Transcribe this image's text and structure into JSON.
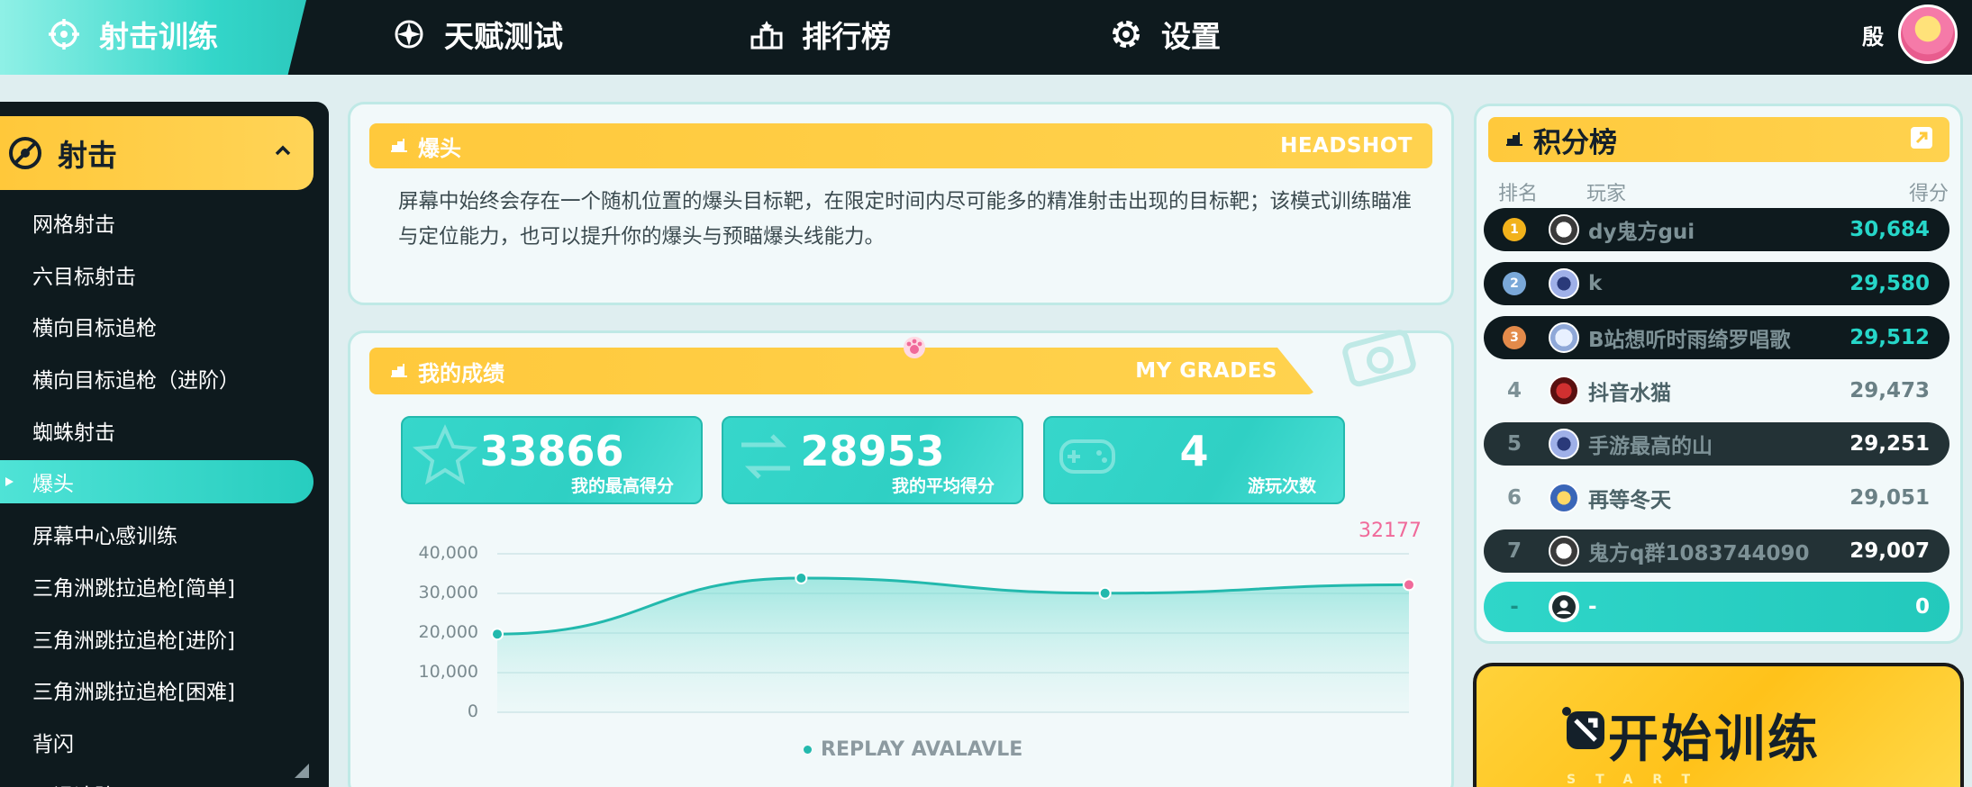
{
  "topnav": {
    "items": [
      {
        "label": "射击训练",
        "icon": "crosshair-icon",
        "active": true
      },
      {
        "label": "天赋测试",
        "icon": "compass-icon"
      },
      {
        "label": "排行榜",
        "icon": "podium-icon"
      },
      {
        "label": "设置",
        "icon": "gear-icon"
      }
    ],
    "user_name": "殷"
  },
  "sidebar": {
    "section_label": "射击",
    "items": [
      {
        "label": "网格射击"
      },
      {
        "label": "六目标射击"
      },
      {
        "label": "横向目标追枪"
      },
      {
        "label": "横向目标追枪（进阶）"
      },
      {
        "label": "蜘蛛射击"
      },
      {
        "label": "爆头",
        "active": true
      },
      {
        "label": "屏幕中心感训练"
      },
      {
        "label": "三角洲跳拉追枪[简单]"
      },
      {
        "label": "三角洲跳拉追枪[进阶]"
      },
      {
        "label": "三角洲跳拉追枪[困难]"
      },
      {
        "label": "背闪"
      },
      {
        "label": "平滑追踪"
      }
    ]
  },
  "mode": {
    "title": "爆头",
    "title_en": "HEADSHOT",
    "description": "屏幕中始终会存在一个随机位置的爆头目标靶，在限定时间内尽可能多的精准射击出现的目标靶；该模式训练瞄准与定位能力，也可以提升你的爆头与预瞄爆头线能力。"
  },
  "grades": {
    "title": "我的成绩",
    "title_en": "MY GRADES",
    "stats": [
      {
        "value": "33866",
        "caption": "我的最高得分"
      },
      {
        "value": "28953",
        "caption": "我的平均得分"
      },
      {
        "value": "4",
        "caption": "游玩次数"
      }
    ],
    "replay_label": "REPLAY AVALAVLE"
  },
  "chart_data": {
    "type": "area",
    "y_ticks": [
      "40,000",
      "30,000",
      "20,000",
      "10,000",
      "0"
    ],
    "ylim": [
      0,
      40000
    ],
    "x": [
      1,
      2,
      3,
      4
    ],
    "values": [
      19725,
      33866,
      30044,
      32177
    ],
    "last_label": "32177",
    "colors": {
      "line": "#23b9ad",
      "last_point": "#f06a9a"
    }
  },
  "leaderboard": {
    "title": "积分榜",
    "columns": [
      "排名",
      "玩家",
      "得分"
    ],
    "rows": [
      {
        "rank": "1",
        "name": "dy鬼方gui",
        "score": "30,684",
        "medal_color": "#f2b21b"
      },
      {
        "rank": "2",
        "name": "k",
        "score": "29,580",
        "medal_color": "#7aa8d8"
      },
      {
        "rank": "3",
        "name": "B站想听时雨绮罗唱歌",
        "score": "29,512",
        "medal_color": "#e38a4a"
      },
      {
        "rank": "4",
        "name": "抖音水猫",
        "score": "29,473"
      },
      {
        "rank": "5",
        "name": "手游最高的山",
        "score": "29,251"
      },
      {
        "rank": "6",
        "name": "再等冬天",
        "score": "29,051"
      },
      {
        "rank": "7",
        "name": "鬼方q群1083744090",
        "score": "29,007"
      }
    ],
    "me": {
      "rank": "-",
      "name": "-",
      "score": "0"
    }
  },
  "start": {
    "label": "开始训练",
    "sub": "START TRAINING"
  }
}
